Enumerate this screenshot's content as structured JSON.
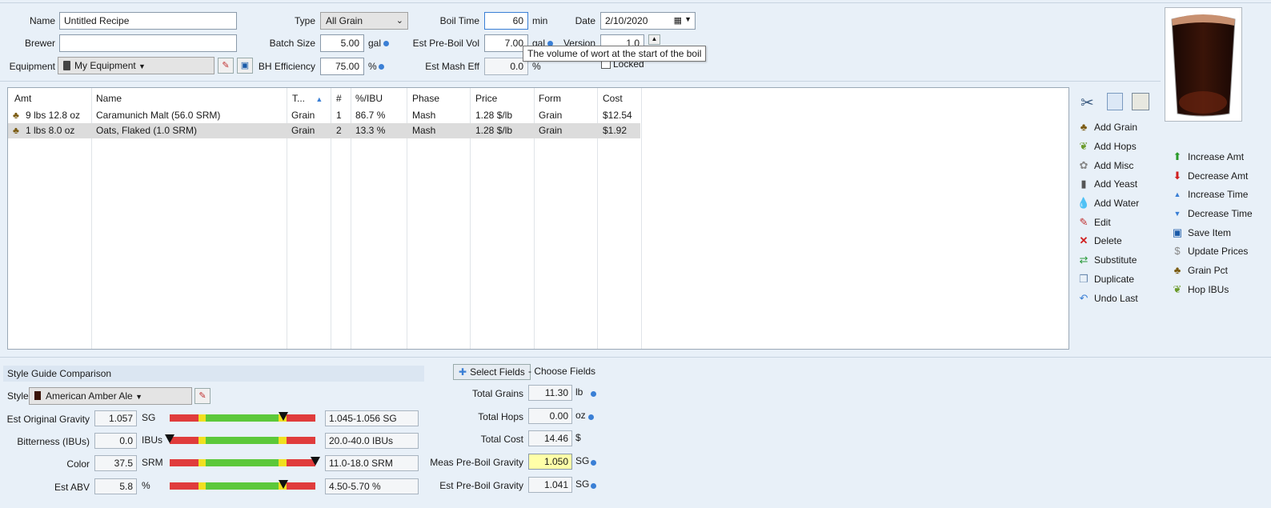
{
  "recipe": {
    "name_label": "Name",
    "name_value": "Untitled Recipe",
    "brewer_label": "Brewer",
    "brewer_value": "",
    "equipment_label": "Equipment",
    "equipment_value": "My Equipment",
    "type_label": "Type",
    "type_value": "All Grain",
    "batch_label": "Batch Size",
    "batch_value": "5.00",
    "batch_unit": "gal",
    "bh_label": "BH Efficiency",
    "bh_value": "75.00",
    "bh_unit": "%",
    "boil_label": "Boil Time",
    "boil_value": "60",
    "boil_unit": "min",
    "preboil_label": "Est Pre-Boil Vol",
    "preboil_value": "7.00",
    "preboil_unit": "gal",
    "mash_label": "Est Mash Eff",
    "mash_value": "0.0",
    "mash_unit": "%",
    "date_label": "Date",
    "date_value": "2/10/2020",
    "version_label": "Version",
    "version_value": "1.0",
    "locked_label": "Locked",
    "tooltip": "The volume of wort at the start of the boil"
  },
  "table": {
    "headers": [
      "Amt",
      "Name",
      "T...",
      "#",
      "%/IBU",
      "Phase",
      "Price",
      "Form",
      "Cost"
    ],
    "rows": [
      {
        "amt": "9 lbs 12.8 oz",
        "name": "Caramunich Malt (56.0 SRM)",
        "type": "Grain",
        "num": "1",
        "pct": "86.7 %",
        "phase": "Mash",
        "price": "1.28 $/lb",
        "form": "Grain",
        "cost": "$12.54"
      },
      {
        "amt": "1 lbs 8.0 oz",
        "name": "Oats, Flaked (1.0 SRM)",
        "type": "Grain",
        "num": "2",
        "pct": "13.3 %",
        "phase": "Mash",
        "price": "1.28 $/lb",
        "form": "Grain",
        "cost": "$1.92"
      }
    ]
  },
  "actions_left": [
    "Add Grain",
    "Add Hops",
    "Add Misc",
    "Add Yeast",
    "Add Water",
    "Edit",
    "Delete",
    "Substitute",
    "Duplicate",
    "Undo Last"
  ],
  "actions_right": [
    "Increase Amt",
    "Decrease Amt",
    "Increase Time",
    "Decrease Time",
    "Save Item",
    "Update Prices",
    "Grain Pct",
    "Hop IBUs"
  ],
  "style": {
    "title": "Style Guide Comparison",
    "style_label": "Style",
    "style_value": "American Amber Ale",
    "rows": [
      {
        "label": "Est Original Gravity",
        "value": "1.057",
        "unit": "SG",
        "range": "1.045-1.056 SG",
        "marker": 0.78
      },
      {
        "label": "Bitterness (IBUs)",
        "value": "0.0",
        "unit": "IBUs",
        "range": "20.0-40.0 IBUs",
        "marker": 0.0
      },
      {
        "label": "Color",
        "value": "37.5",
        "unit": "SRM",
        "range": "11.0-18.0 SRM",
        "marker": 1.0
      },
      {
        "label": "Est ABV",
        "value": "5.8",
        "unit": "%",
        "range": "4.50-5.70 %",
        "marker": 0.78
      }
    ]
  },
  "fields": {
    "select_button": "Select Fields",
    "choose_label": "- Choose Fields",
    "rows": [
      {
        "label": "Total Grains",
        "value": "11.30",
        "unit": "lb"
      },
      {
        "label": "Total Hops",
        "value": "0.00",
        "unit": "oz"
      },
      {
        "label": "Total Cost",
        "value": "14.46",
        "unit": "$"
      },
      {
        "label": "Meas Pre-Boil Gravity",
        "value": "1.050",
        "unit": "SG"
      },
      {
        "label": "Est Pre-Boil Gravity",
        "value": "1.041",
        "unit": "SG"
      }
    ]
  },
  "colors": {
    "accent": "#3a7fd5",
    "beer": "#3a1408",
    "gauge_red": "#e03c3c",
    "gauge_yellow": "#f0e020",
    "gauge_green": "#5cc83a"
  }
}
